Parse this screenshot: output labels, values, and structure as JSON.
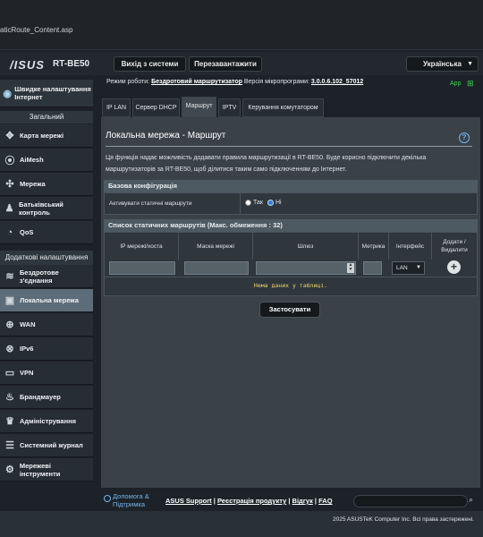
{
  "browser": {
    "url": "aticRoute_Content.asp"
  },
  "header": {
    "logo": "/ISUS",
    "model": "RT-BE50",
    "logout_label": "Вихід з системи",
    "reboot_label": "Перезавантажити",
    "language": "Українська"
  },
  "status": {
    "mode_label": "Режим роботи:",
    "mode_value": "Бездротовий маршрутизатор",
    "fw_label": "Версія мікропрограми:",
    "fw_value": "3.0.0.6.102_57012",
    "app_label": "App"
  },
  "sidebar": {
    "qis_label": "Швидке налаштування Інтернет",
    "general_header": "Загальний",
    "general_items": [
      {
        "label": "Карта мережі",
        "icon": "network-map-icon"
      },
      {
        "label": "AiMesh",
        "icon": "aimesh-icon"
      },
      {
        "label": "Мережа",
        "icon": "network-icon"
      },
      {
        "label": "Батьківський контроль",
        "icon": "parental-control-icon"
      },
      {
        "label": "QoS",
        "icon": "qos-icon"
      }
    ],
    "advanced_header": "Додаткові налаштування",
    "advanced_items": [
      {
        "label": "Бездротове з'єднання",
        "icon": "wireless-icon"
      },
      {
        "label": "Локальна мережа",
        "icon": "lan-icon"
      },
      {
        "label": "WAN",
        "icon": "wan-icon"
      },
      {
        "label": "IPv6",
        "icon": "ipv6-icon"
      },
      {
        "label": "VPN",
        "icon": "vpn-icon"
      },
      {
        "label": "Брандмауер",
        "icon": "firewall-icon"
      },
      {
        "label": "Адміністрування",
        "icon": "administration-icon"
      },
      {
        "label": "Системний журнал",
        "icon": "system-log-icon"
      },
      {
        "label": "Мережеві інструменти",
        "icon": "network-tools-icon"
      }
    ]
  },
  "tabs": [
    "IP LAN",
    "Сервер DHCP",
    "Маршрут",
    "IPTV",
    "Керування комутатором"
  ],
  "main": {
    "title": "Локальна мережа - Маршрут",
    "description": "Ця функція надає можливість додавати правила маршрутизації в RT-BE50. Буде корисно підключити декілька маршрутизаторів за RT-BE50, щоб ділитися таким само підключенням до Інтернет.",
    "basic_header": "Базова конфігурація",
    "enable_label": "Активувати статичні маршрути",
    "radio_yes": "Так",
    "radio_no": "Ні",
    "list_header": "Список статичних маршрутів (Макс. обмеження : 32)",
    "columns": [
      "IP мережі/хоста",
      "Маска мережі",
      "Шлюз",
      "Метрика",
      "Інтерфейс",
      "Додати / Видалити"
    ],
    "iface_value": "LAN",
    "empty_message": "Нема даних у таблиці.",
    "apply_label": "Застосувати"
  },
  "footer": {
    "help_label": "Допомога & Підтримка",
    "links": [
      "ASUS Support",
      "Реєстрація продукту",
      "Відгук",
      "FAQ"
    ],
    "copyright": "2025 ASUSTeK Computer Inc. Всі права застережені."
  }
}
